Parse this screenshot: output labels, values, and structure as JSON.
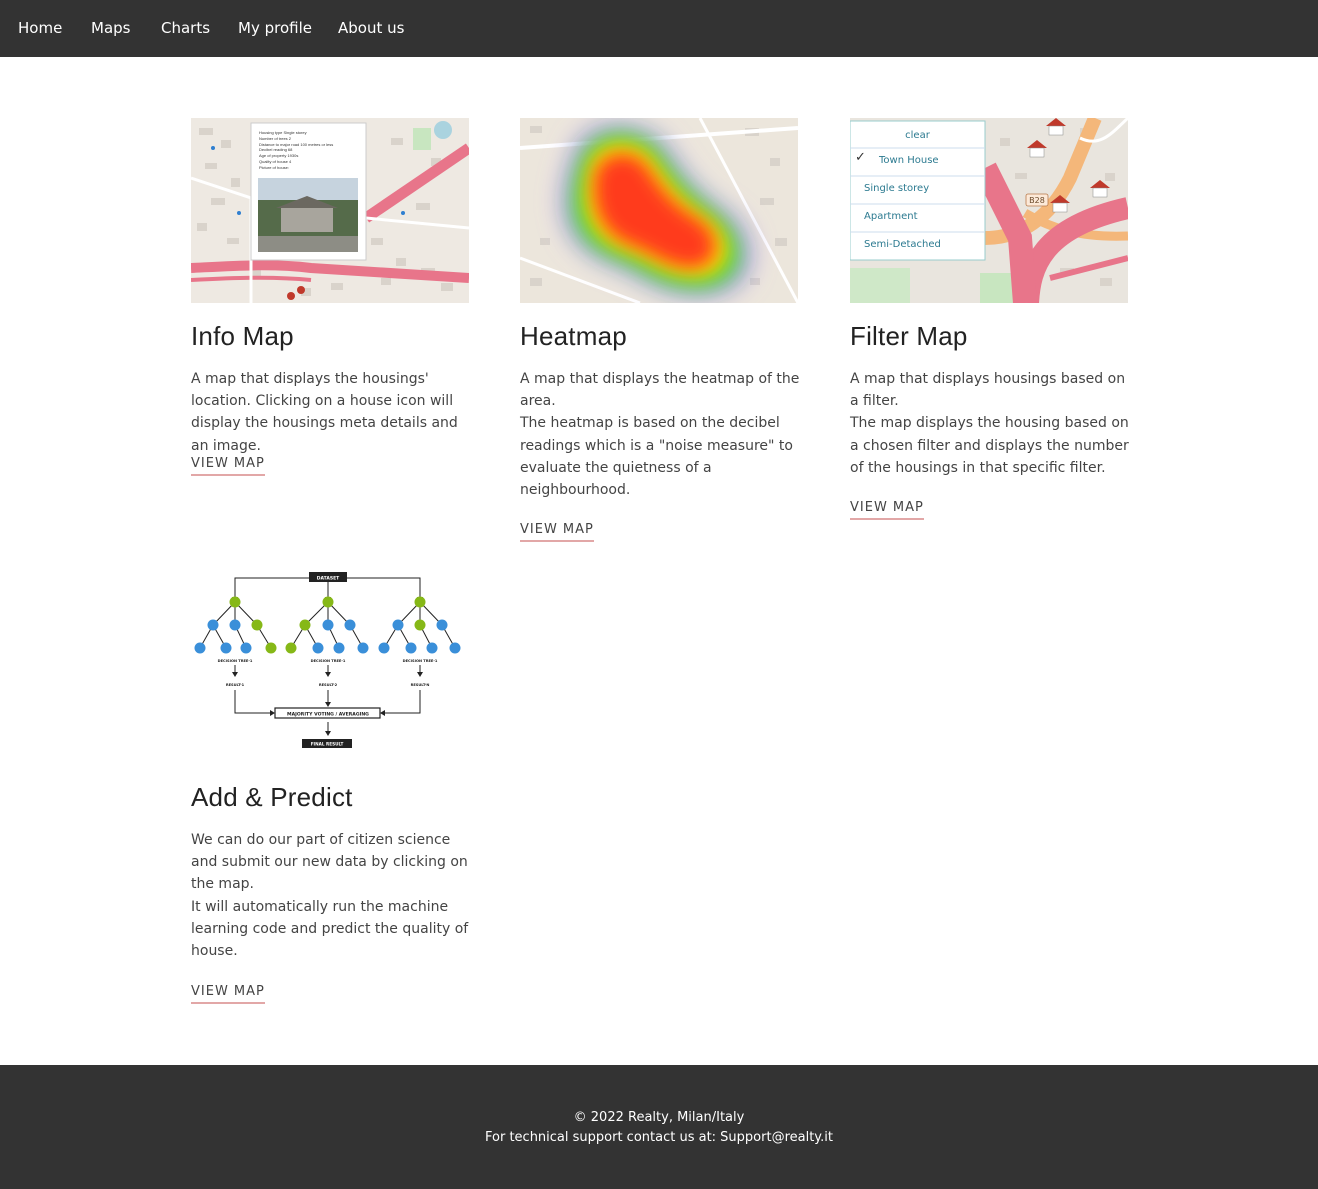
{
  "nav": {
    "items": [
      {
        "label": "Home"
      },
      {
        "label": "Maps"
      },
      {
        "label": "Charts"
      },
      {
        "label": "My profile"
      },
      {
        "label": "About us"
      }
    ]
  },
  "cards": [
    {
      "title": "Info Map",
      "paragraphs": [
        "A map that displays the housings' location. Clicking on a house icon will display the housings meta details and an image."
      ],
      "link": "VIEW MAP",
      "popup_lines": [
        "Housing type Single storey",
        "Number of trees 2",
        "Distance to major road 100 metres or less",
        "Decibel reading 68",
        "Age of property 1930s",
        "Quality of house 4",
        "Picture of house:"
      ]
    },
    {
      "title": "Heatmap",
      "paragraphs": [
        "A map that displays the heatmap of the area.",
        "The heatmap is based on the decibel readings which is a \"noise measure\" to evaluate the quietness of a neighbourhood."
      ],
      "link": "VIEW MAP"
    },
    {
      "title": "Filter Map",
      "paragraphs": [
        "A map that displays housings based on a filter.",
        "The map displays the housing based on a chosen filter and displays the number of the housings in that specific filter."
      ],
      "link": "VIEW MAP",
      "filter_options": [
        "clear",
        "Town House",
        "Single storey",
        "Apartment",
        "Semi-Detached"
      ],
      "road_label": "B28"
    },
    {
      "title": "Add & Predict",
      "paragraphs": [
        "We can do our part of citizen science and submit our new data by clicking on the map.",
        "It will automatically run the machine learning code and predict the quality of house."
      ],
      "link": "VIEW MAP",
      "diagram": {
        "input": "DATASET",
        "trees": [
          "DECISION TREE-1",
          "DECISION TREE-1",
          "DECISION TREE-1"
        ],
        "results": [
          "RESULT-1",
          "RESULT-2",
          "RESULT-N"
        ],
        "aggregate": "MAJORITY VOTING / AVERAGING",
        "final": "FINAL RESULT"
      }
    }
  ],
  "footer": {
    "line1": "© 2022 Realty, Milan/Italy",
    "line2": "For technical support contact us at: Support@realty.it"
  },
  "colors": {
    "navbar": "#333333",
    "footer": "#333333",
    "link_underline": "#e2a7a7",
    "tree_node_blue": "#3a8fd9",
    "tree_node_green": "#86b817"
  }
}
